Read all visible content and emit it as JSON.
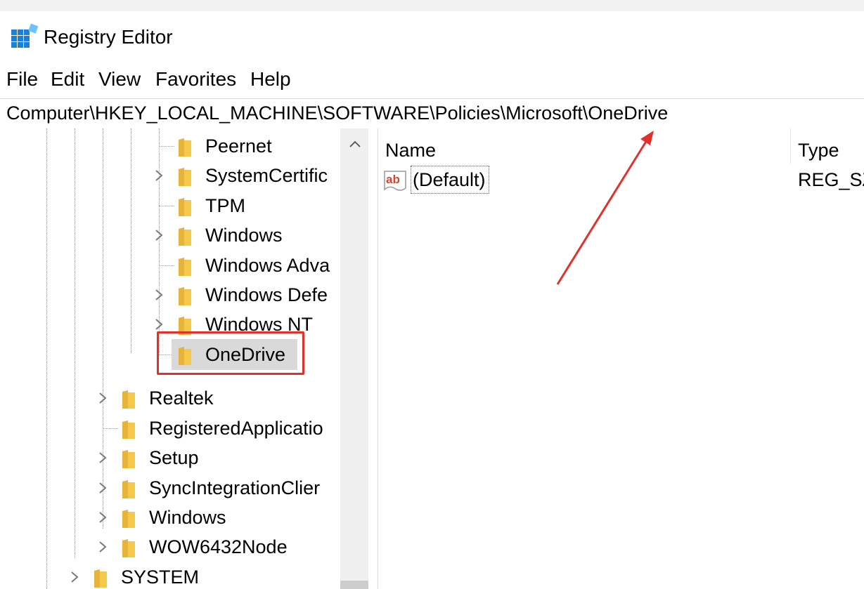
{
  "window": {
    "title": "Registry Editor",
    "icon": "registry-editor-icon"
  },
  "menu": {
    "items": [
      "File",
      "Edit",
      "View",
      "Favorites",
      "Help"
    ]
  },
  "address": {
    "path": "Computer\\HKEY_LOCAL_MACHINE\\SOFTWARE\\Policies\\Microsoft\\OneDrive"
  },
  "tree": {
    "nodes": [
      {
        "label": "Peernet",
        "expandable": false
      },
      {
        "label": "SystemCertific",
        "expandable": true
      },
      {
        "label": "TPM",
        "expandable": false
      },
      {
        "label": "Windows",
        "expandable": true
      },
      {
        "label": "Windows Adva",
        "expandable": false
      },
      {
        "label": "Windows Defe",
        "expandable": true
      },
      {
        "label": "Windows NT",
        "expandable": true
      },
      {
        "label": "OneDrive",
        "expandable": false,
        "selected": true
      },
      {
        "label": "Realtek",
        "expandable": true
      },
      {
        "label": "RegisteredApplicatio",
        "expandable": false
      },
      {
        "label": "Setup",
        "expandable": true
      },
      {
        "label": "SyncIntegrationClier",
        "expandable": true
      },
      {
        "label": "Windows",
        "expandable": true
      },
      {
        "label": "WOW6432Node",
        "expandable": true
      },
      {
        "label": "SYSTEM",
        "expandable": true
      }
    ]
  },
  "list": {
    "columns": {
      "name": "Name",
      "type": "Type"
    },
    "rows": [
      {
        "name": "(Default)",
        "type": "REG_SZ",
        "icon": "string-value-icon"
      }
    ]
  },
  "colors": {
    "accent_annotation": "#e5302a",
    "folder": "#f5c84c",
    "selection": "#d9d9d9"
  }
}
